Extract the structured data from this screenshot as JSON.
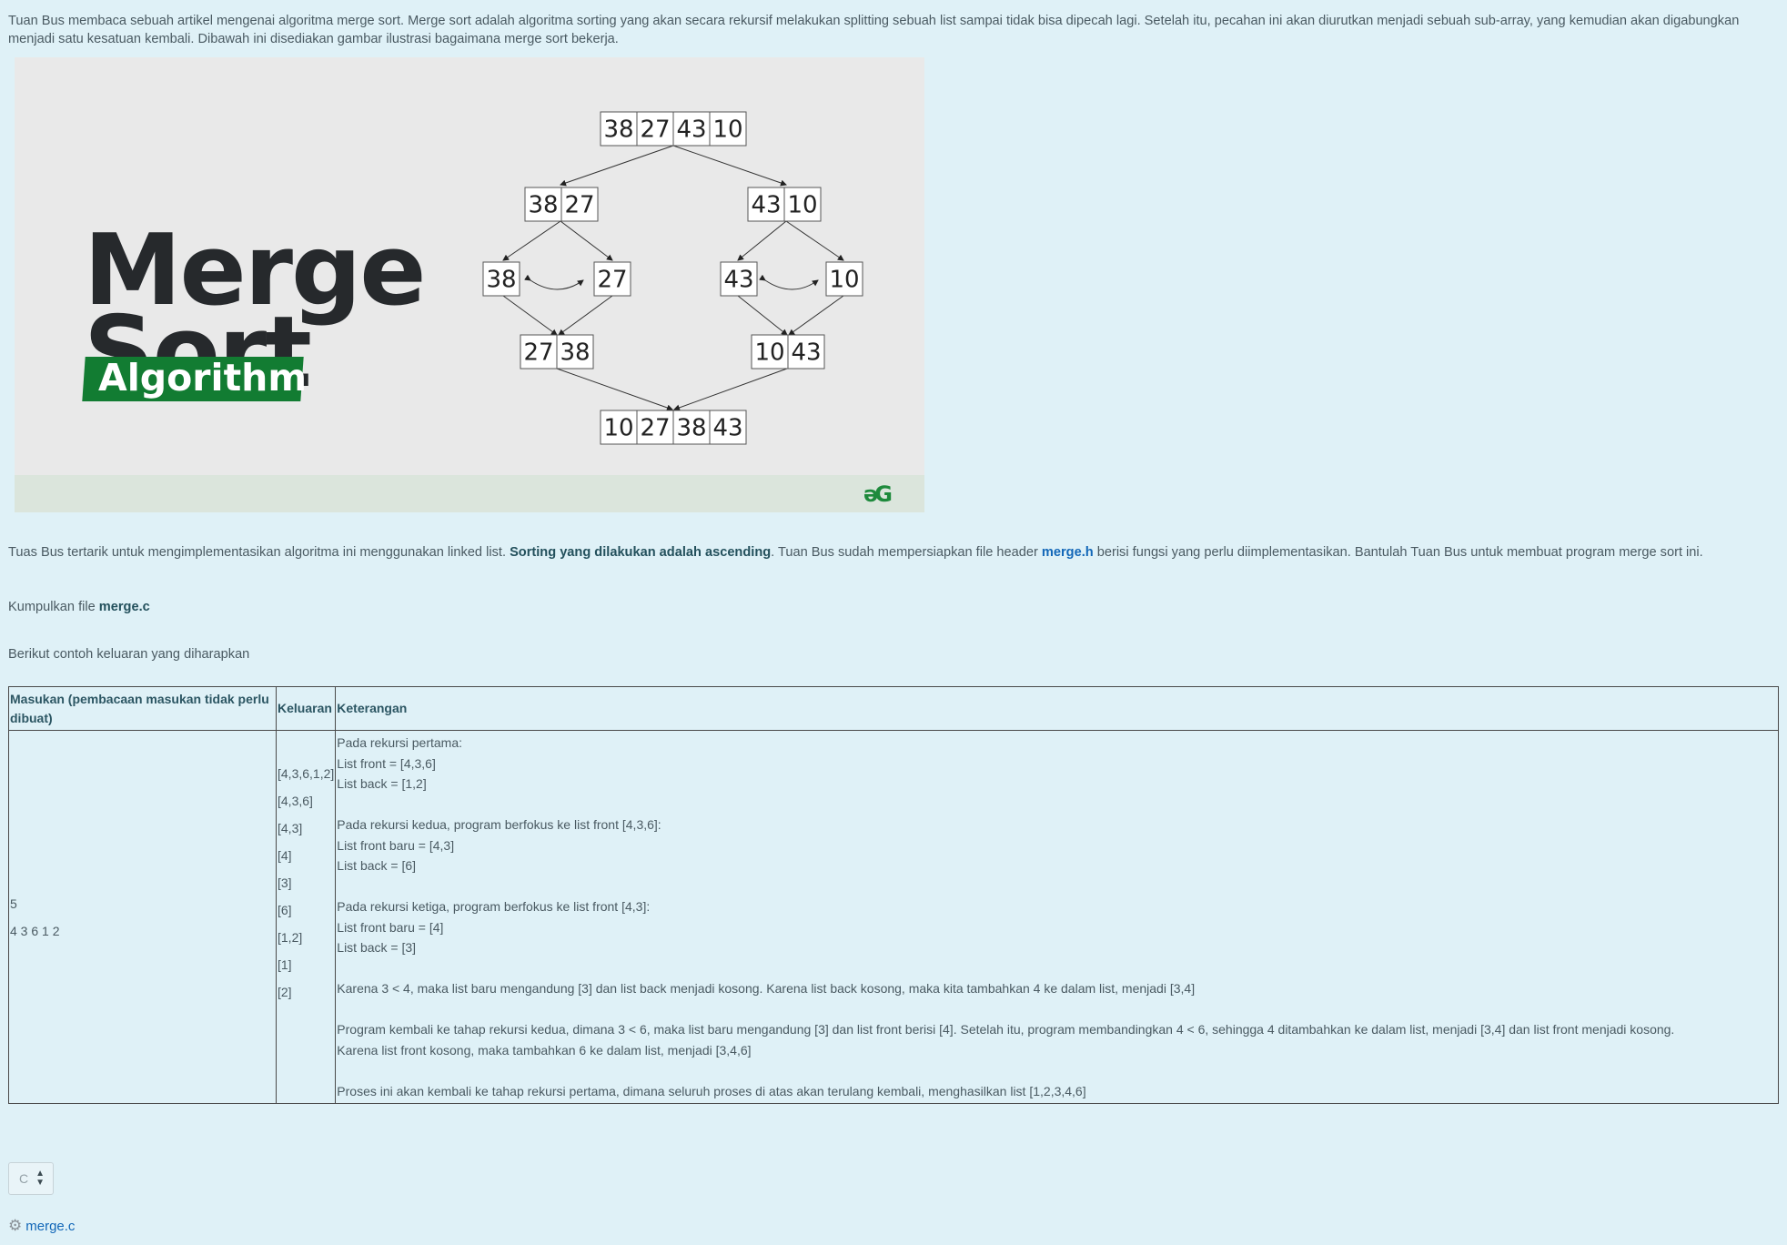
{
  "intro": {
    "text": "Tuan Bus membaca sebuah artikel mengenai algoritma merge sort. Merge sort adalah algoritma sorting yang akan secara rekursif melakukan splitting sebuah list sampai tidak bisa dipecah lagi. Setelah itu, pecahan ini akan diurutkan menjadi sebuah sub-array, yang kemudian akan digabungkan menjadi satu kesatuan kembali. Dibawah ini disediakan gambar ilustrasi bagaimana merge sort bekerja."
  },
  "illustration": {
    "title_line1": "Merge",
    "title_line2": "Sort",
    "subtitle": "Algorithm",
    "logo": "əG",
    "tree": {
      "level0": [
        "38",
        "27",
        "43",
        "10"
      ],
      "level1_left": [
        "38",
        "27"
      ],
      "level1_right": [
        "43",
        "10"
      ],
      "level2": [
        "38",
        "27",
        "43",
        "10"
      ],
      "level3_left": [
        "27",
        "38"
      ],
      "level3_right": [
        "10",
        "43"
      ],
      "level4": [
        "10",
        "27",
        "38",
        "43"
      ]
    },
    "colors": {
      "background": "#e9e9e9",
      "footer": "#dbe5dc",
      "tag": "#127c32",
      "title": "#26292c"
    }
  },
  "desc": {
    "part1": "Tuas Bus tertarik untuk mengimplementasikan algoritma ini menggunakan linked list. ",
    "bold": "Sorting yang dilakukan adalah ascending",
    "part2": ". Tuan Bus sudah mempersiapkan file header ",
    "header_link": "merge.h",
    "part3": " berisi fungsi yang perlu diimplementasikan. Bantulah Tuan Bus untuk membuat program merge sort ini."
  },
  "submit": {
    "prefix": "Kumpulkan file ",
    "file": "merge.c"
  },
  "example_intro": "Berikut contoh keluaran yang diharapkan",
  "table": {
    "headers": [
      "Masukan (pembacaan masukan tidak perlu dibuat)",
      "Keluaran",
      "Keterangan"
    ],
    "input_lines": [
      "5",
      "4 3 6 1 2"
    ],
    "output_lines": [
      "[4,3,6,1,2]",
      "[4,3,6]",
      "[4,3]",
      "[4]",
      "[3]",
      "[6]",
      "[1,2]",
      "[1]",
      "[2]"
    ],
    "ket_lines": [
      "Pada rekursi pertama:",
      "List front = [4,3,6]",
      "List back = [1,2]",
      "",
      "Pada rekursi kedua, program berfokus ke list front [4,3,6]:",
      "List front baru = [4,3]",
      "List back = [6]",
      "",
      "Pada rekursi ketiga, program berfokus ke list front [4,3]:",
      "List front baru = [4]",
      "List back = [3]",
      "",
      "Karena 3 < 4, maka list baru mengandung [3] dan list back menjadi kosong. Karena list back kosong, maka kita tambahkan 4 ke dalam list, menjadi [3,4]",
      "",
      "Program kembali ke tahap rekursi kedua, dimana 3 < 6, maka list baru mengandung [3] dan list front berisi [4]. Setelah itu, program membandingkan 4 < 6, sehingga 4 ditambahkan ke dalam list, menjadi [3,4] dan list front menjadi kosong.",
      "Karena list front kosong, maka tambahkan 6 ke dalam list, menjadi [3,4,6]",
      "",
      "Proses ini akan kembali ke tahap rekursi pertama, dimana seluruh proses di atas akan terulang kembali, menghasilkan list [1,2,3,4,6]"
    ]
  },
  "language_select": {
    "value": "C"
  },
  "attachment": {
    "icon": "gear-icon",
    "file": "merge.c"
  }
}
